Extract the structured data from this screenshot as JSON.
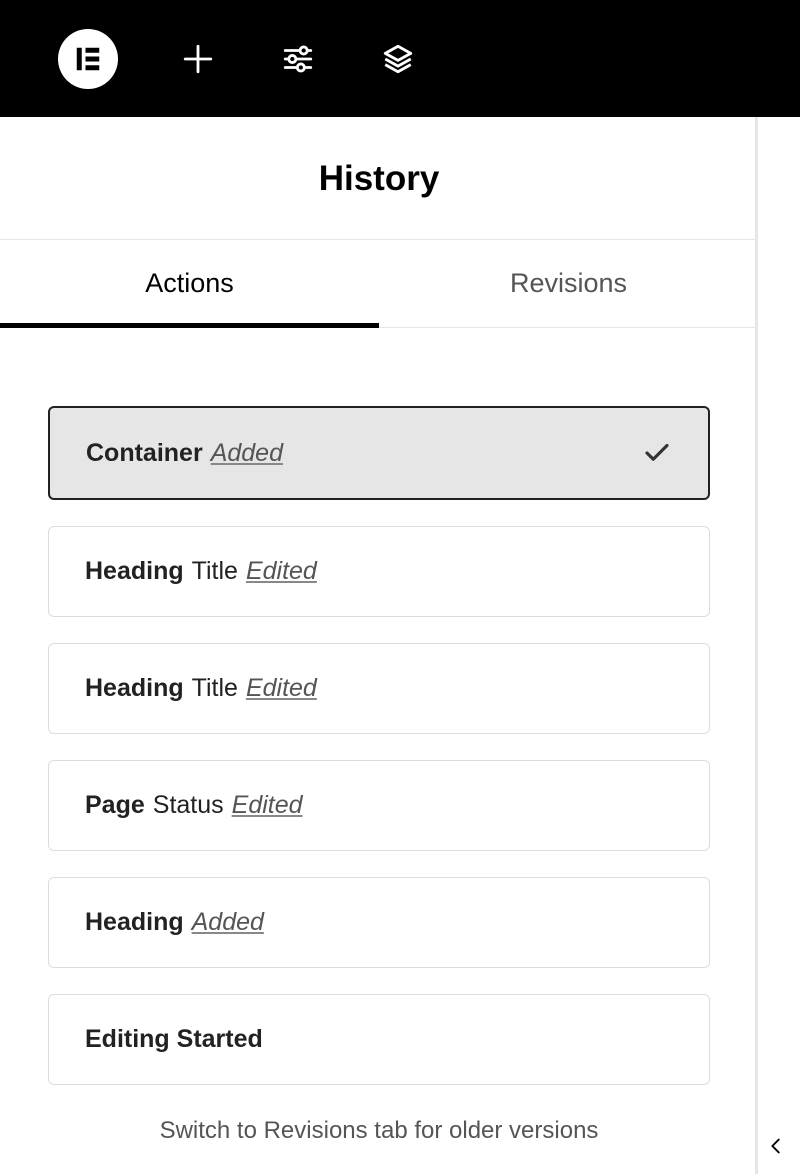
{
  "panel": {
    "title": "History"
  },
  "tabs": {
    "actions": "Actions",
    "revisions": "Revisions"
  },
  "history": [
    {
      "element": "Container",
      "subtitle": "",
      "action": "Added",
      "selected": true
    },
    {
      "element": "Heading",
      "subtitle": "Title",
      "action": "Edited",
      "selected": false
    },
    {
      "element": "Heading",
      "subtitle": "Title",
      "action": "Edited",
      "selected": false
    },
    {
      "element": "Page",
      "subtitle": "Status",
      "action": "Edited",
      "selected": false
    },
    {
      "element": "Heading",
      "subtitle": "",
      "action": "Added",
      "selected": false
    },
    {
      "element": "Editing Started",
      "subtitle": "",
      "action": "",
      "selected": false
    }
  ],
  "footer": {
    "note": "Switch to Revisions tab for older versions"
  }
}
